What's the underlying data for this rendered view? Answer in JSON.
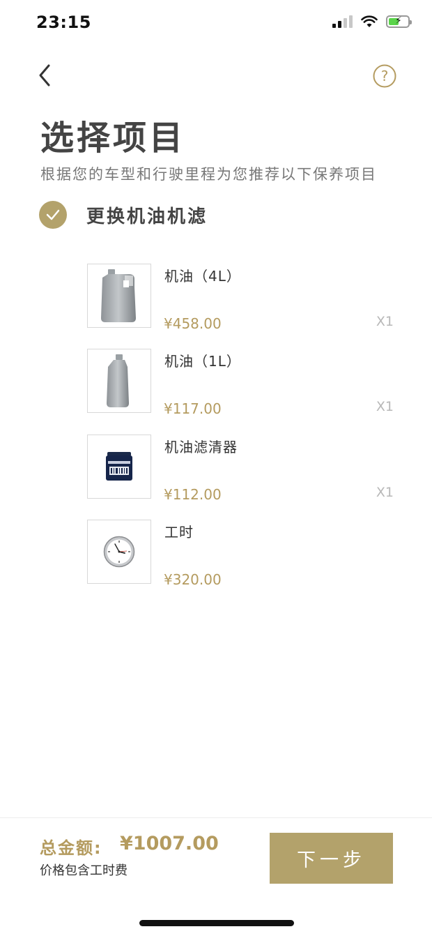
{
  "status_bar": {
    "time": "23:15"
  },
  "header": {
    "title": "选择项目",
    "subtitle": "根据您的车型和行驶里程为您推荐以下保养项目"
  },
  "section": {
    "title": "更换机油机滤",
    "checked": true
  },
  "items": [
    {
      "name": "机油（4L）",
      "price": "¥458.00",
      "qty": "X1",
      "icon": "oil-jug-icon"
    },
    {
      "name": "机油（1L）",
      "price": "¥117.00",
      "qty": "X1",
      "icon": "oil-bottle-icon"
    },
    {
      "name": "机油滤清器",
      "price": "¥112.00",
      "qty": "X1",
      "icon": "oil-filter-icon"
    },
    {
      "name": "工时",
      "price": "¥320.00",
      "icon": "clock-icon"
    }
  ],
  "footer": {
    "total_label": "总金额:",
    "total_value": "¥1007.00",
    "note": "价格包含工时费",
    "next_label": "下一步"
  },
  "colors": {
    "accent": "#b3a26b",
    "price": "#b49b5f",
    "title": "#444444",
    "qty": "#b8b8b8"
  }
}
